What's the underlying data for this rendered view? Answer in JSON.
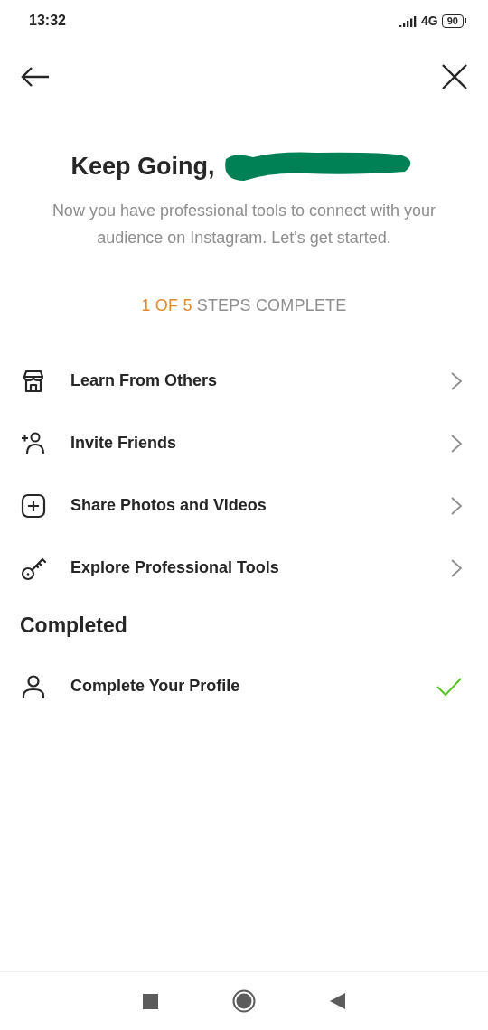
{
  "status_bar": {
    "time": "13:32",
    "network": "4G",
    "battery": "90"
  },
  "header": {
    "title": "Keep Going,",
    "name_redacted": true,
    "subtitle": "Now you have professional tools to connect with your audience on Instagram. Let's get started."
  },
  "progress": {
    "count": "1 OF 5",
    "label": "STEPS COMPLETE"
  },
  "tasks": [
    {
      "label": "Learn From Others"
    },
    {
      "label": "Invite Friends"
    },
    {
      "label": "Share Photos and Videos"
    },
    {
      "label": "Explore Professional Tools"
    }
  ],
  "completed": {
    "heading": "Completed",
    "items": [
      {
        "label": "Complete Your Profile"
      }
    ]
  }
}
